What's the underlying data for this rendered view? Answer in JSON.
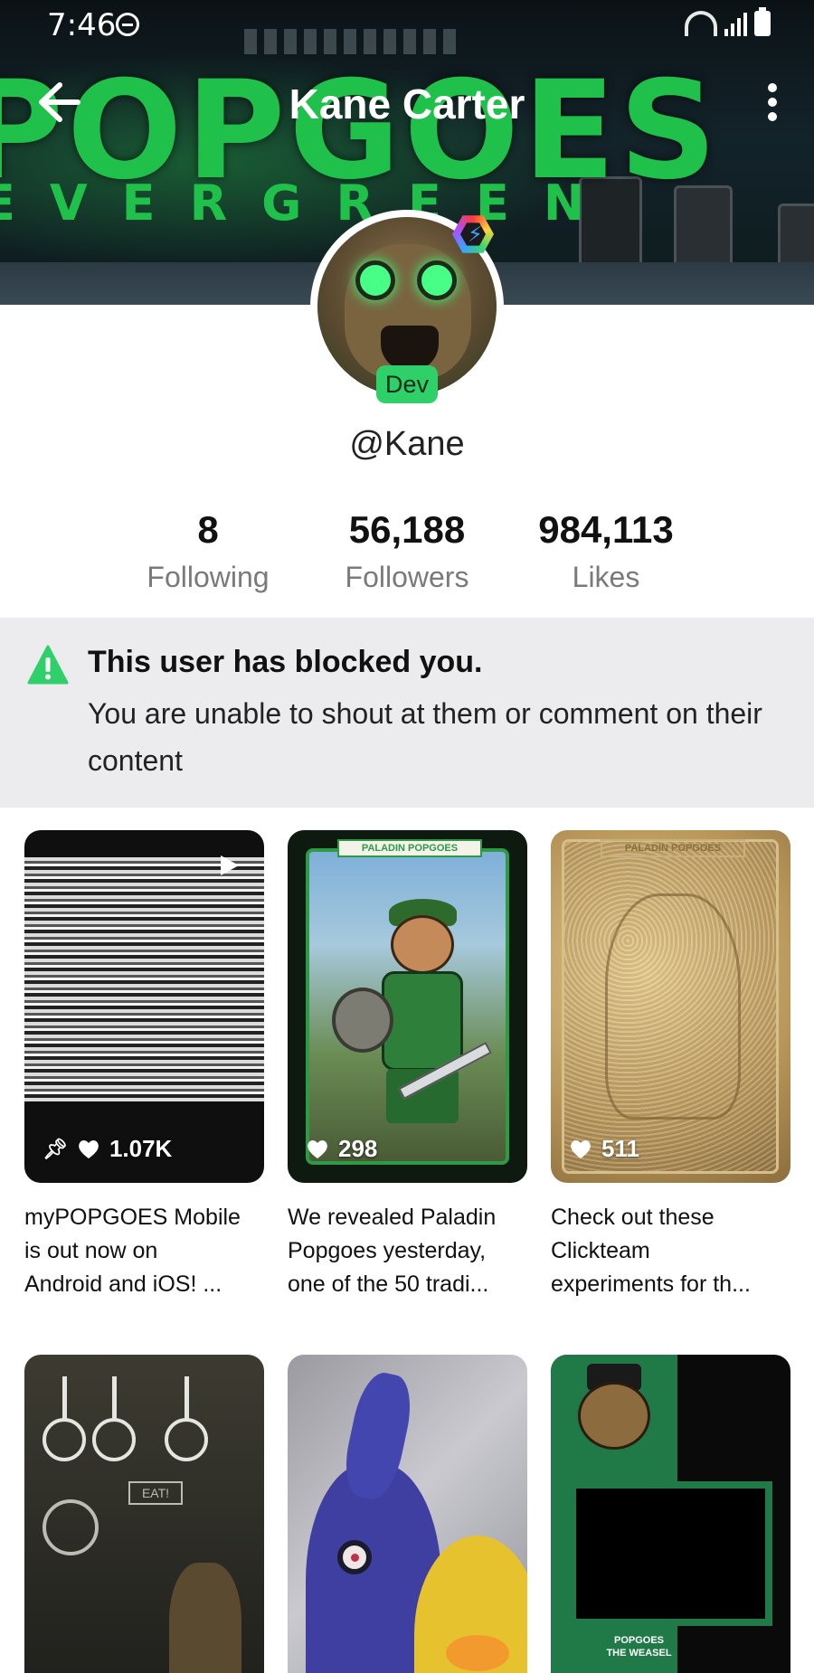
{
  "status_bar": {
    "time": "7:46"
  },
  "header": {
    "title": "Kane Carter",
    "banner_logo": "POPGOES",
    "banner_sub": "EVERGREEN"
  },
  "profile": {
    "role_badge": "Dev",
    "username": "@Kane",
    "stats": [
      {
        "value": "8",
        "label": "Following"
      },
      {
        "value": "56,188",
        "label": "Followers"
      },
      {
        "value": "984,113",
        "label": "Likes"
      }
    ]
  },
  "notice": {
    "title": "This user has blocked you.",
    "text": "You are unable to shout at them or comment on their content"
  },
  "posts": [
    {
      "likes": "1.07K",
      "pinned": true,
      "video": true,
      "caption_lines": [
        "myPOPGOES Mobile",
        "is out now on",
        "Android and iOS!  ..."
      ]
    },
    {
      "likes": "298",
      "pinned": false,
      "video": false,
      "card_title": "PALADIN POPGOES",
      "caption_lines": [
        "We revealed Paladin",
        "Popgoes yesterday,",
        "one of the 50 tradi..."
      ]
    },
    {
      "likes": "511",
      "pinned": false,
      "video": false,
      "card_title": "PALADIN POPGOES",
      "caption_lines": [
        "Check out these",
        "Clickteam",
        "experiments for th..."
      ]
    },
    {
      "sign_text": "EAT!"
    },
    {},
    {
      "box_text": "POPGOES THE WEASEL"
    }
  ],
  "colors": {
    "accent_green": "#2fd06a",
    "notice_bg": "#ececee",
    "warning": "#2fd06a"
  }
}
